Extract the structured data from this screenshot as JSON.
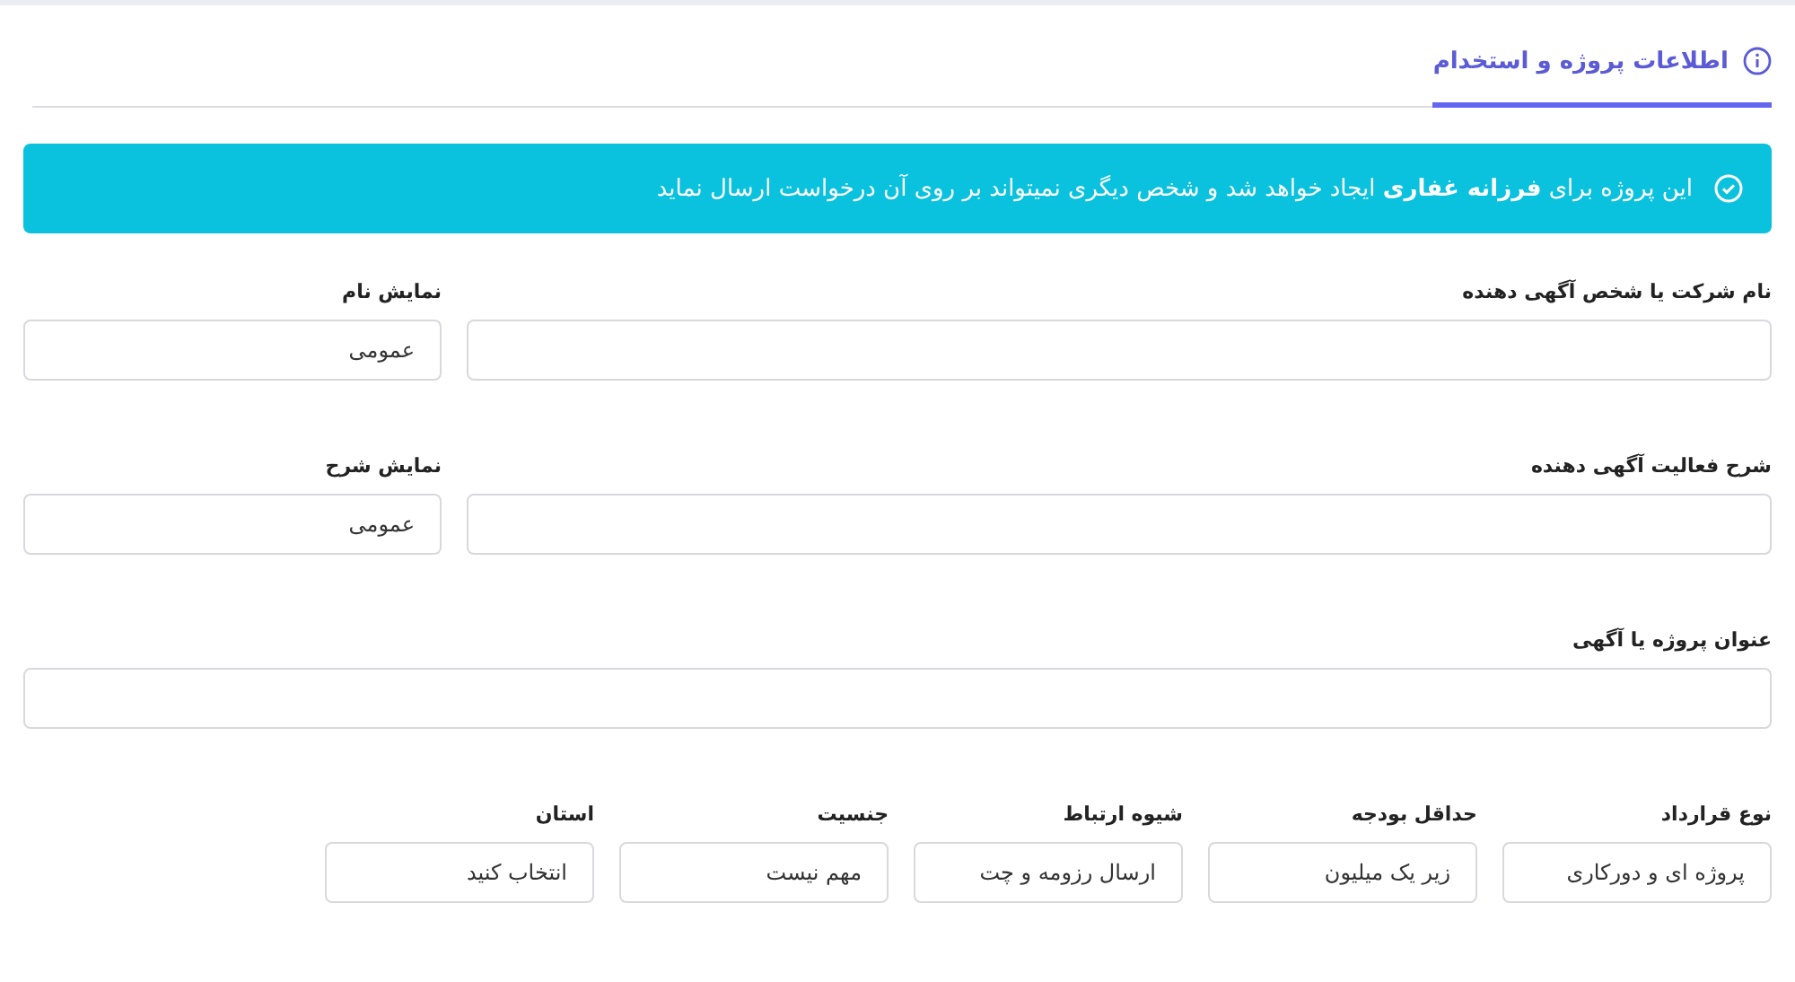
{
  "tabs": [
    {
      "label": "اطلاعات پروژه و استخدام",
      "selected": true
    }
  ],
  "alert": {
    "text": "این پروژه برای **فرزانه غفاری** ایجاد خواهد شد و شخص دیگری نمیتواند بر روی آن درخواست ارسال نماید"
  },
  "rows": [
    {
      "field": {
        "label": "نام شرکت یا شخص آگهی دهنده"
      },
      "visibility": {
        "label": "نمایش نام",
        "value": "عمومی"
      }
    },
    {
      "field": {
        "label": "شرح فعالیت آگهی دهنده"
      },
      "visibility": {
        "label": "نمایش شرح",
        "value": "عمومی"
      }
    }
  ],
  "title_field": {
    "label": "عنوان پروژه یا آگهی"
  },
  "selects": [
    {
      "label": "نوع قرارداد",
      "value": "پروژه ای و دورکاری"
    },
    {
      "label": "حداقل بودجه",
      "value": "زیر یک میلیون"
    },
    {
      "label": "شیوه ارتباط",
      "value": "ارسال رزومه و چت"
    },
    {
      "label": "جنسیت",
      "value": "مهم نیست"
    },
    {
      "label": "استان",
      "value": "انتخاب کنید"
    }
  ]
}
